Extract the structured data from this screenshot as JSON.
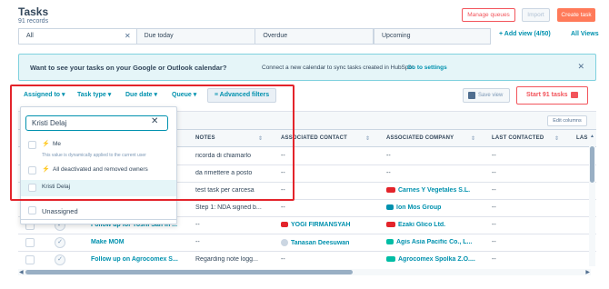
{
  "header": {
    "title": "Tasks",
    "records": "91 records",
    "manage_queues": "Manage queues",
    "import": "Import",
    "create_task": "Create task"
  },
  "views": {
    "tabs": [
      {
        "label": "All",
        "active": true
      },
      {
        "label": "Due today"
      },
      {
        "label": "Overdue"
      },
      {
        "label": "Upcoming"
      }
    ],
    "add_view": "+ Add view (4/50)",
    "all_views": "All Views"
  },
  "banner": {
    "question": "Want to see your tasks on your Google or Outlook calendar?",
    "text": "Connect a new calendar to sync tasks created in HubSpot.",
    "link": "Go to settings"
  },
  "filters": {
    "assigned_to": "Assigned to ▾",
    "task_type": "Task type ▾",
    "due_date": "Due date ▾",
    "queue": "Queue ▾",
    "advanced": "Advanced filters",
    "save_view": "Save view",
    "start_tasks": "Start 91 tasks"
  },
  "dropdown": {
    "search_value": "Kristi Delaj",
    "options": [
      {
        "label": "Me",
        "help": "This value is dynamically applied to the current user"
      },
      {
        "label": "All deactivated and removed owners"
      },
      {
        "label": "Kristi Delaj"
      },
      {
        "label": "Unassigned"
      }
    ]
  },
  "table": {
    "edit_columns": "Edit columns",
    "columns": [
      "NOTES",
      "ASSOCIATED CONTACT",
      "ASSOCIATED COMPANY",
      "LAST CONTACTED",
      "LAS"
    ],
    "rows": [
      {
        "title": "",
        "notes": "ricorda di chiamarlo",
        "contact": "--",
        "company": "--",
        "last": "--"
      },
      {
        "title": "",
        "notes": "da rimettere a posto",
        "contact": "--",
        "company": "--",
        "last": "--"
      },
      {
        "title": "",
        "notes": "test task per carcesa",
        "contact": "--",
        "company": "Carnes Y Vegetales S.L.",
        "last": "--"
      },
      {
        "title": "",
        "notes": "Step 1: NDA signed b...",
        "contact": "--",
        "company": "Ion Mos Group",
        "last": "--"
      },
      {
        "title": "Follow up for Yoshi San in ...",
        "notes": "--",
        "contact": "YOGI FIRMANSYAH",
        "company": "Ezaki Glico Ltd.",
        "last": "--"
      },
      {
        "title": "Make MOM",
        "notes": "--",
        "contact": "Tanasan Deesuwan",
        "company": "Agis Asia Pacific Co., L...",
        "last": "--"
      },
      {
        "title": "Follow up on Agrocomex S...",
        "notes": "Regarding note logg...",
        "contact": "--",
        "company": "Agrocomex Spolka Z.O....",
        "last": "--"
      }
    ]
  },
  "colors": {
    "accent": "#0091ae",
    "brand": "#ff7a59",
    "highlight": "#e3242b"
  }
}
